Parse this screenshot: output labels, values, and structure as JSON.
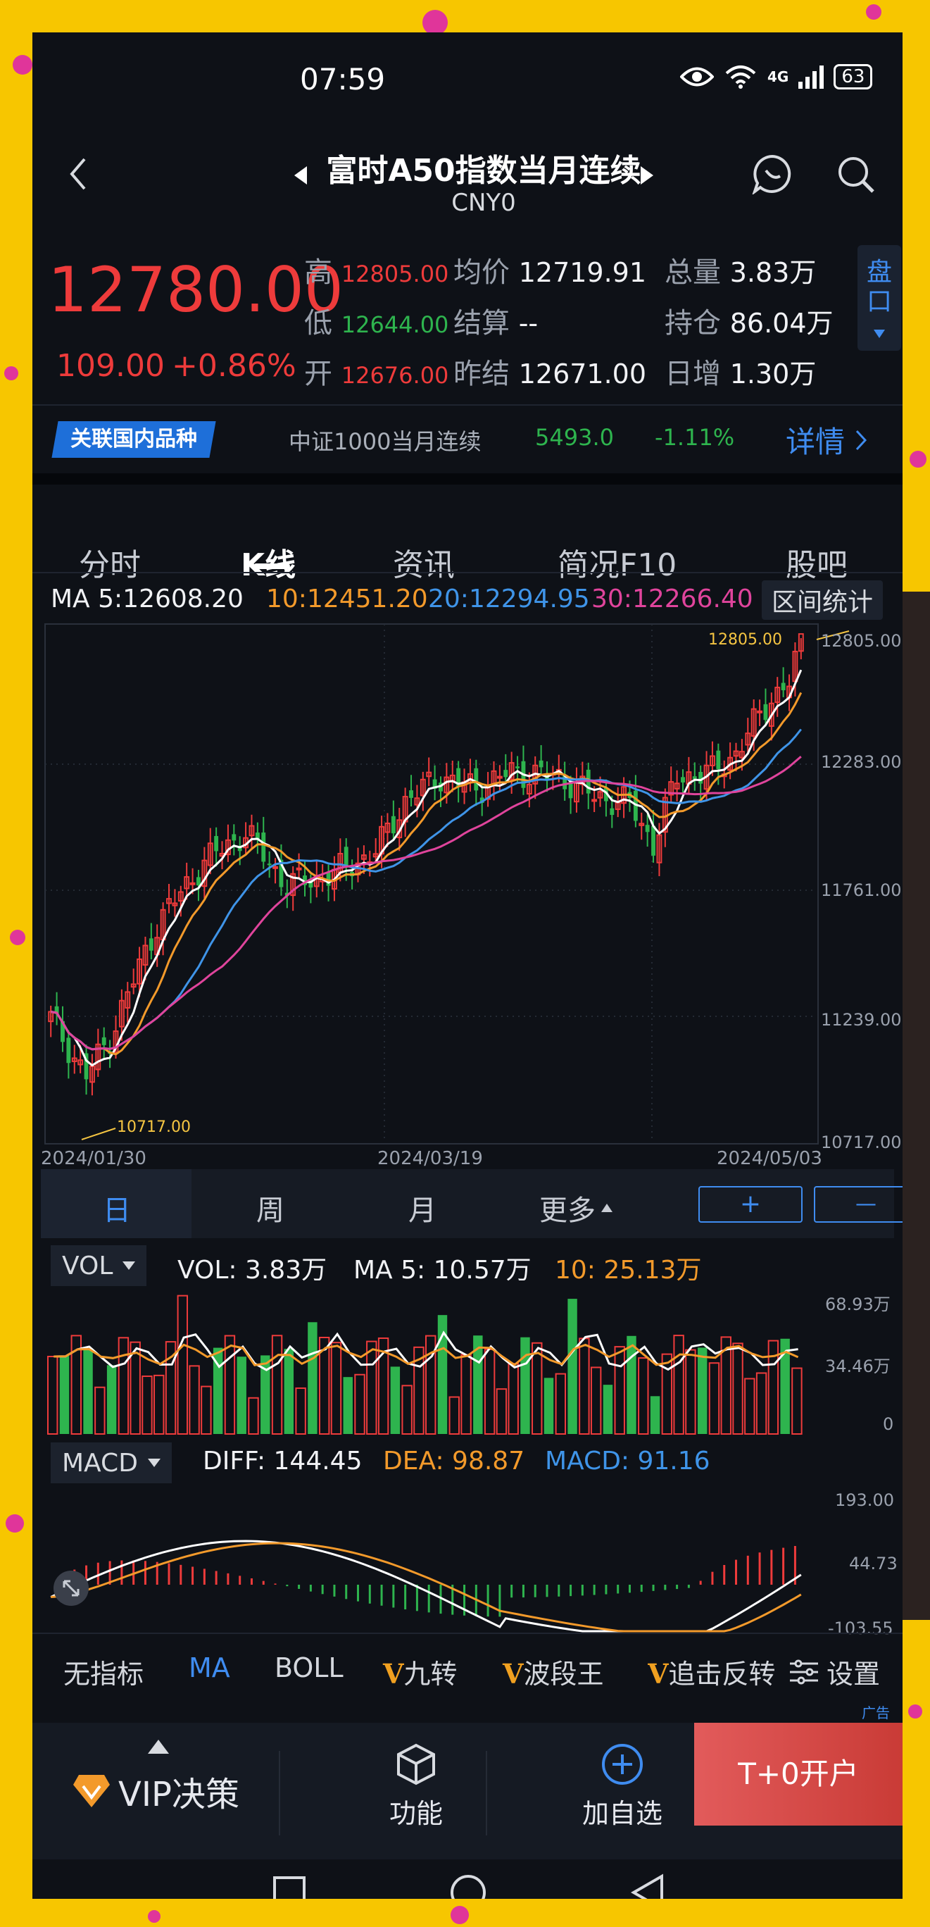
{
  "status_bar": {
    "time": "07:59",
    "network": "4G",
    "battery": "63"
  },
  "header": {
    "title": "富时A50指数当月连续",
    "code": "CNY0"
  },
  "quote": {
    "price": "12780.00",
    "change": "109.00",
    "change_pct": "+0.86%",
    "stats": [
      {
        "label": "高",
        "value": "12805.00"
      },
      {
        "label": "均价",
        "value": "12719.91"
      },
      {
        "label": "总量",
        "value": "3.83万"
      },
      {
        "label": "低",
        "value": "12644.00"
      },
      {
        "label": "结算",
        "value": "--"
      },
      {
        "label": "持仓",
        "value": "86.04万"
      },
      {
        "label": "开",
        "value": "12676.00"
      },
      {
        "label": "昨结",
        "value": "12671.00"
      },
      {
        "label": "日增",
        "value": "1.30万"
      }
    ],
    "pankou": "盘口"
  },
  "related": {
    "badge": "关联国内品种",
    "name": "中证1000当月连续",
    "price": "5493.0",
    "pct": "-1.11%",
    "detail": "详情"
  },
  "tabs": [
    "分时",
    "K线",
    "资讯",
    "简况F10",
    "股吧"
  ],
  "ma_line": {
    "ma5": "MA 5:12608.20",
    "ma10": "10:12451.20",
    "ma20": "20:12294.95",
    "ma30": "30:12266.40",
    "range_btn": "区间统计"
  },
  "kline": {
    "y_labels": [
      "12805.00",
      "12283.00",
      "11761.00",
      "11239.00",
      "10717.00"
    ],
    "x_labels": [
      "2024/01/30",
      "2024/03/19",
      "2024/05/03"
    ],
    "high_label": "12805.00",
    "low_label": "10717.00"
  },
  "periods": {
    "day": "日",
    "week": "周",
    "month": "月",
    "more": "更多",
    "plus": "+",
    "minus": "—"
  },
  "vol": {
    "selector": "VOL",
    "vol": "VOL:  3.83万",
    "ma5": "MA 5:  10.57万",
    "ma10": "10:  25.13万",
    "y_labels": [
      "68.93万",
      "34.46万",
      "0"
    ]
  },
  "macd": {
    "selector": "MACD",
    "diff": "DIFF: 144.45",
    "dea": "DEA: 98.87",
    "macd": "MACD: 91.16",
    "y_labels": [
      "193.00",
      "44.73",
      "-103.55"
    ]
  },
  "indicators": [
    "无指标",
    "MA",
    "BOLL",
    "九转",
    "波段王",
    "追击反转",
    "设置"
  ],
  "ad_label": "广告",
  "bottom_bar": {
    "vip": "VIP决策",
    "func": "功能",
    "add": "加自选",
    "open": "T+0开户"
  },
  "colors": {
    "up": "#ee3b3b",
    "down": "#2eb44e",
    "ma5": "#ffffff",
    "ma10": "#f39a2b",
    "ma20": "#3f94e8",
    "ma30": "#e0449c",
    "accent": "#3f8cf0"
  }
}
